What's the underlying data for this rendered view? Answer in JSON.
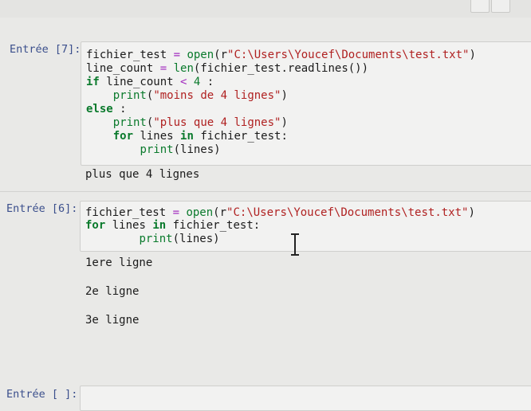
{
  "cells": [
    {
      "prompt": "Entrée [7]:",
      "code_tokens": [
        [
          [
            "name",
            "fichier_test "
          ],
          [
            "op",
            "="
          ],
          [
            "name",
            " "
          ],
          [
            "bi",
            "open"
          ],
          [
            "name",
            "(r"
          ],
          [
            "str",
            "\"C:\\Users\\Youcef\\Documents\\test.txt\""
          ],
          [
            "name",
            ")"
          ]
        ],
        [
          [
            "name",
            "line_count "
          ],
          [
            "op",
            "="
          ],
          [
            "name",
            " "
          ],
          [
            "bi",
            "len"
          ],
          [
            "name",
            "(fichier_test.readlines())"
          ]
        ],
        [
          [
            "kw",
            "if"
          ],
          [
            "name",
            " line_count "
          ],
          [
            "op",
            "<"
          ],
          [
            "name",
            " "
          ],
          [
            "num",
            "4"
          ],
          [
            "name",
            " :"
          ]
        ],
        [
          [
            "name",
            "    "
          ],
          [
            "bi",
            "print"
          ],
          [
            "name",
            "("
          ],
          [
            "str",
            "\"moins de 4 lignes\""
          ],
          [
            "name",
            ")"
          ]
        ],
        [
          [
            "kw",
            "else"
          ],
          [
            "name",
            " :"
          ]
        ],
        [
          [
            "name",
            "    "
          ],
          [
            "bi",
            "print"
          ],
          [
            "name",
            "("
          ],
          [
            "str",
            "\"plus que 4 lignes\""
          ],
          [
            "name",
            ")"
          ]
        ],
        [
          [
            "name",
            "    "
          ],
          [
            "kw",
            "for"
          ],
          [
            "name",
            " lines "
          ],
          [
            "kw",
            "in"
          ],
          [
            "name",
            " fichier_test:"
          ]
        ],
        [
          [
            "name",
            "        "
          ],
          [
            "bi",
            "print"
          ],
          [
            "name",
            "(lines)"
          ]
        ]
      ],
      "output": [
        "plus que 4 lignes"
      ]
    },
    {
      "prompt": "Entrée [6]:",
      "code_tokens": [
        [
          [
            "name",
            "fichier_test "
          ],
          [
            "op",
            "="
          ],
          [
            "name",
            " "
          ],
          [
            "bi",
            "open"
          ],
          [
            "name",
            "(r"
          ],
          [
            "str",
            "\"C:\\Users\\Youcef\\Documents\\test.txt\""
          ],
          [
            "name",
            ")"
          ]
        ],
        [
          [
            "kw",
            "for"
          ],
          [
            "name",
            " lines "
          ],
          [
            "kw",
            "in"
          ],
          [
            "name",
            " fichier_test:"
          ]
        ],
        [
          [
            "name",
            "        "
          ],
          [
            "bi",
            "print"
          ],
          [
            "name",
            "(lines)"
          ]
        ]
      ],
      "output": [
        "1ere ligne",
        "2e ligne",
        "3e ligne"
      ]
    },
    {
      "prompt": "Entrée [ ]:",
      "code_tokens": [],
      "output": []
    }
  ],
  "icons": {
    "toolbar_button_1": "toolbar-button-icon",
    "toolbar_button_2": "toolbar-button-icon",
    "cursor": "text-cursor-icon"
  },
  "colors": {
    "keyword": "#0a7a2c",
    "string": "#b02121",
    "operator": "#a32dbf",
    "prompt": "#3b4f8c"
  }
}
